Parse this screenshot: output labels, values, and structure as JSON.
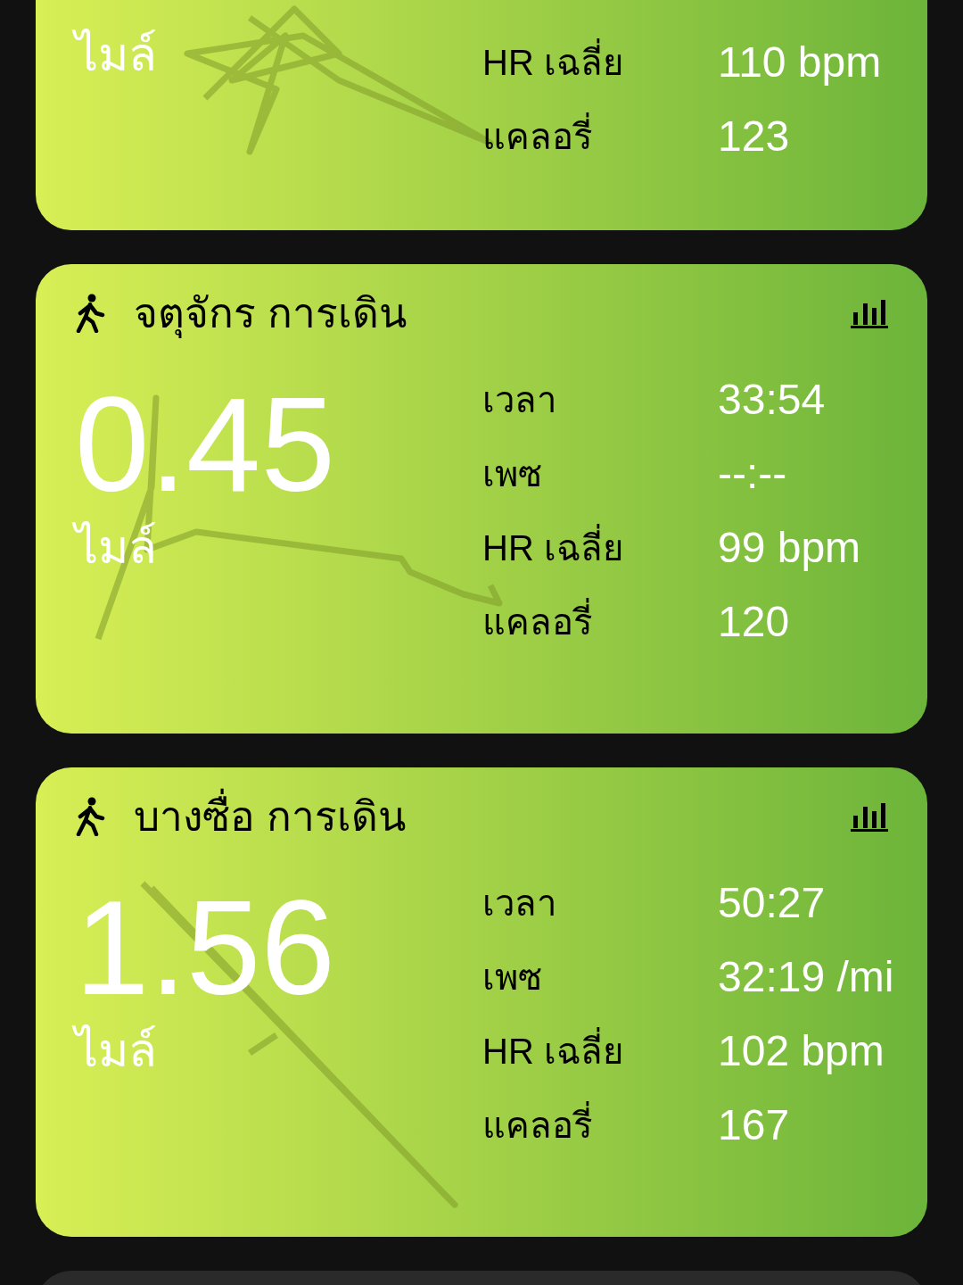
{
  "partial_card": {
    "unit": "ไมล์",
    "stats": [
      {
        "label": "HR เฉลี่ย",
        "value": "110 bpm"
      },
      {
        "label": "แคลอรี่",
        "value": "123"
      }
    ]
  },
  "cards": [
    {
      "title": "จตุจักร การเดิน",
      "distance": "0.45",
      "unit": "ไมล์",
      "stats": [
        {
          "label": "เวลา",
          "value": "33:54"
        },
        {
          "label": "เพซ",
          "value": "--:--"
        },
        {
          "label": "HR เฉลี่ย",
          "value": "99 bpm"
        },
        {
          "label": "แคลอรี่",
          "value": "120"
        }
      ]
    },
    {
      "title": "บางซื่อ การเดิน",
      "distance": "1.56",
      "unit": "ไมล์",
      "stats": [
        {
          "label": "เวลา",
          "value": "50:27"
        },
        {
          "label": "เพซ",
          "value": "32:19 /mi"
        },
        {
          "label": "HR เฉลี่ย",
          "value": "102 bpm"
        },
        {
          "label": "แคลอรี่",
          "value": "167"
        }
      ]
    }
  ]
}
